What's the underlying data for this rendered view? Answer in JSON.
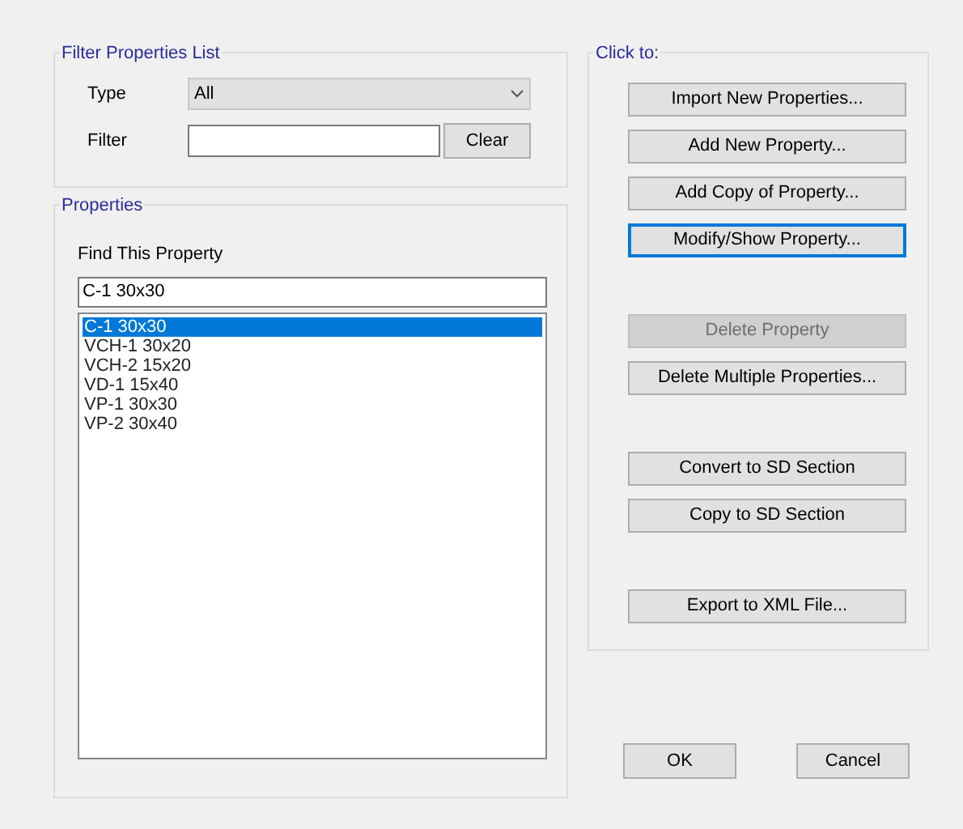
{
  "filter_group": {
    "title": "Filter Properties List",
    "type_label": "Type",
    "type_value": "All",
    "filter_label": "Filter",
    "clear_button": "Clear"
  },
  "properties_group": {
    "title": "Properties",
    "find_label": "Find This Property",
    "find_value": "C-1 30x30",
    "items": [
      {
        "label": "C-1 30x30",
        "selected": true
      },
      {
        "label": "VCH-1 30x20",
        "selected": false
      },
      {
        "label": "VCH-2 15x20",
        "selected": false
      },
      {
        "label": "VD-1 15x40",
        "selected": false
      },
      {
        "label": "VP-1 30x30",
        "selected": false
      },
      {
        "label": "VP-2 30x40",
        "selected": false
      }
    ]
  },
  "actions_group": {
    "title": "Click to:",
    "button_groups": [
      [
        {
          "label": "Import New Properties...",
          "disabled": false,
          "focused": false
        },
        {
          "label": "Add New Property...",
          "disabled": false,
          "focused": false
        },
        {
          "label": "Add Copy of Property...",
          "disabled": false,
          "focused": false
        },
        {
          "label": "Modify/Show Property...",
          "disabled": false,
          "focused": true
        }
      ],
      [
        {
          "label": "Delete Property",
          "disabled": true,
          "focused": false
        },
        {
          "label": "Delete Multiple Properties...",
          "disabled": false,
          "focused": false
        }
      ],
      [
        {
          "label": "Convert to SD Section",
          "disabled": false,
          "focused": false
        },
        {
          "label": "Copy to SD Section",
          "disabled": false,
          "focused": false
        }
      ],
      [
        {
          "label": "Export to XML File...",
          "disabled": false,
          "focused": false
        }
      ]
    ]
  },
  "buttons": [
    "OK",
    "Cancel"
  ]
}
